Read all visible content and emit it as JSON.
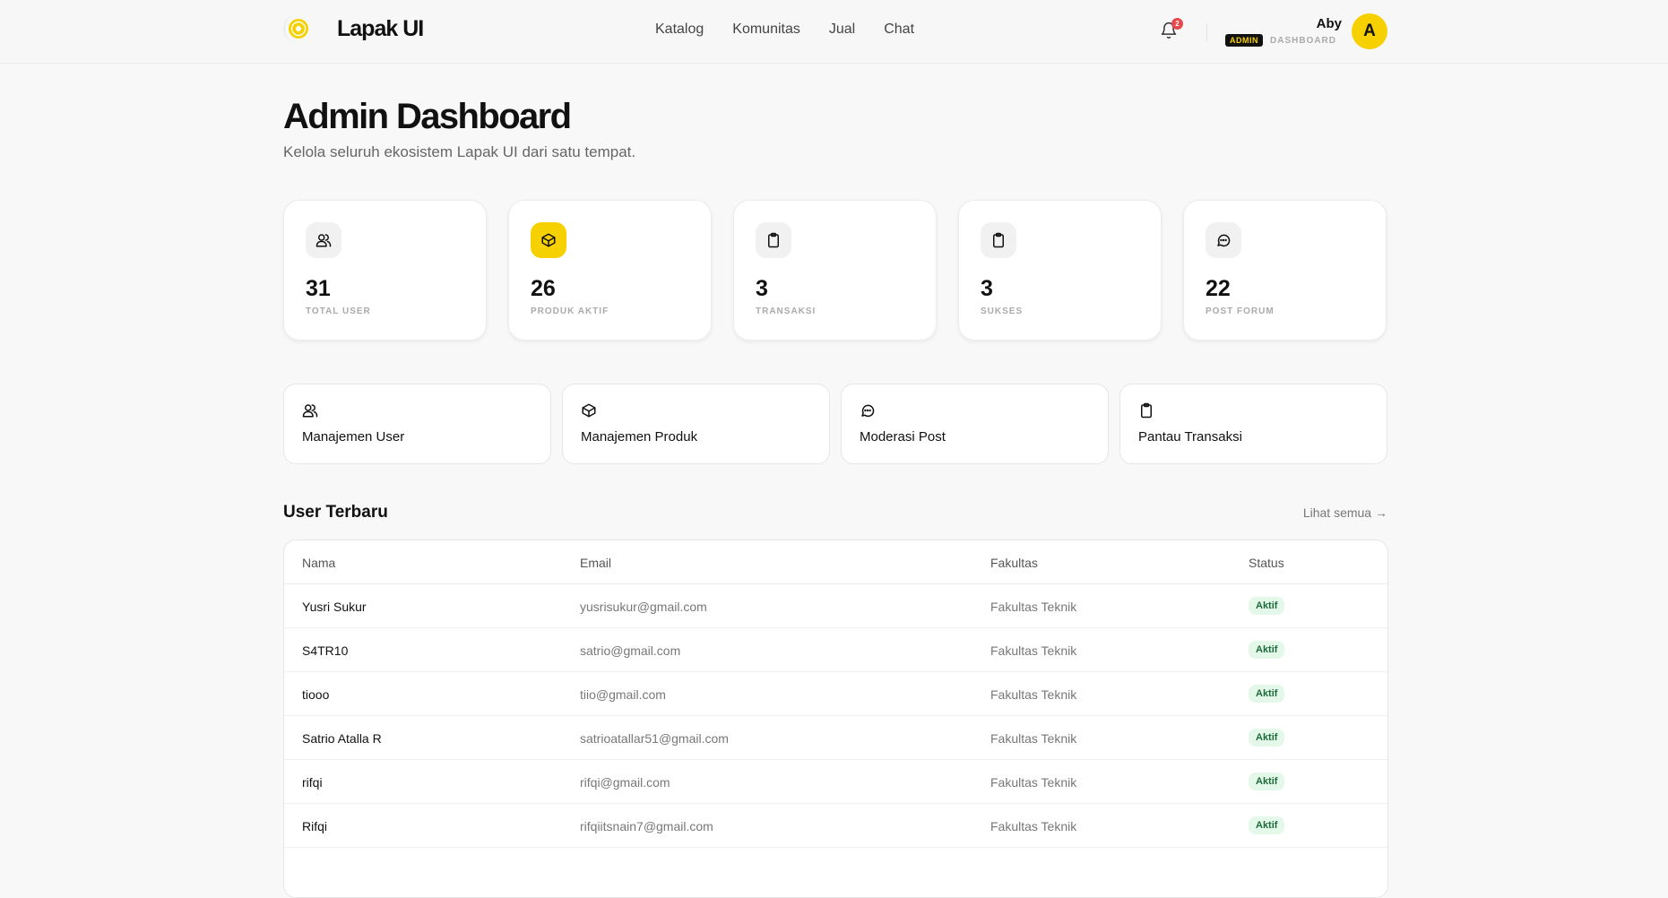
{
  "app": {
    "name": "Lapak UI"
  },
  "nav": {
    "items": [
      "Katalog",
      "Komunitas",
      "Jual",
      "Chat"
    ]
  },
  "notifications": {
    "count": "2"
  },
  "user": {
    "name": "Aby",
    "role": "ADMIN",
    "role_sub": "DASHBOARD",
    "avatar_initial": "A"
  },
  "page": {
    "title": "Admin Dashboard",
    "subtitle": "Kelola seluruh ekosistem Lapak UI dari satu tempat."
  },
  "stats": [
    {
      "icon": "users-icon",
      "value": "31",
      "label": "TOTAL USER",
      "highlight": false
    },
    {
      "icon": "box-icon",
      "value": "26",
      "label": "PRODUK AKTIF",
      "highlight": true
    },
    {
      "icon": "clipboard-icon",
      "value": "3",
      "label": "TRANSAKSI",
      "highlight": false
    },
    {
      "icon": "clipboard-icon",
      "value": "3",
      "label": "SUKSES",
      "highlight": false
    },
    {
      "icon": "chat-icon",
      "value": "22",
      "label": "POST FORUM",
      "highlight": false
    }
  ],
  "actions": [
    {
      "icon": "users-icon",
      "label": "Manajemen User"
    },
    {
      "icon": "box-icon",
      "label": "Manajemen Produk"
    },
    {
      "icon": "chat-icon",
      "label": "Moderasi Post"
    },
    {
      "icon": "clipboard-icon",
      "label": "Pantau Transaksi"
    }
  ],
  "recent_users": {
    "title": "User Terbaru",
    "see_all": "Lihat semua →",
    "columns": [
      "Nama",
      "Email",
      "Fakultas",
      "Status"
    ],
    "rows": [
      {
        "name": "Yusri Sukur",
        "email": "yusrisukur@gmail.com",
        "faculty": "Fakultas Teknik",
        "status": "Aktif"
      },
      {
        "name": "S4TR10",
        "email": "satrio@gmail.com",
        "faculty": "Fakultas Teknik",
        "status": "Aktif"
      },
      {
        "name": "tiooo",
        "email": "tiio@gmail.com",
        "faculty": "Fakultas Teknik",
        "status": "Aktif"
      },
      {
        "name": "Satrio Atalla R",
        "email": "satrioatallar51@gmail.com",
        "faculty": "Fakultas Teknik",
        "status": "Aktif"
      },
      {
        "name": "rifqi",
        "email": "rifqi@gmail.com",
        "faculty": "Fakultas Teknik",
        "status": "Aktif"
      },
      {
        "name": "Rifqi",
        "email": "rifqiitsnain7@gmail.com",
        "faculty": "Fakultas Teknik",
        "status": "Aktif"
      }
    ]
  },
  "colors": {
    "accent": "#f7d000",
    "status_bg": "#e4f8ea",
    "status_fg": "#1d6b3a",
    "badge": "#e5484d"
  }
}
